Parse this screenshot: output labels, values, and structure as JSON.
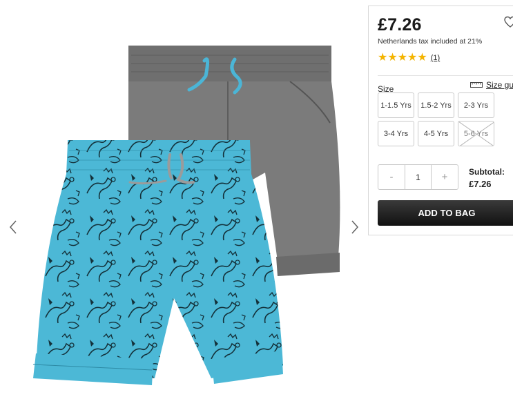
{
  "gallery": {
    "image_alt": "Two pack of boys shorts: grey chino shorts and turquoise dinosaur print shorts",
    "prev_icon": "chevron-left-icon",
    "next_icon": "chevron-right-icon"
  },
  "product": {
    "price": "£7.26",
    "tax_note": "Netherlands tax included at 21%",
    "rating": {
      "value": 5,
      "max": 5,
      "review_count": "(1)"
    },
    "wishlist_icon": "heart-icon"
  },
  "size": {
    "label": "Size",
    "guide_label": "Size guide",
    "guide_icon": "ruler-icon",
    "options": [
      {
        "label": "1-1.5 Yrs",
        "available": true
      },
      {
        "label": "1.5-2 Yrs",
        "available": true
      },
      {
        "label": "2-3 Yrs",
        "available": true
      },
      {
        "label": "3-4 Yrs",
        "available": true
      },
      {
        "label": "4-5 Yrs",
        "available": true
      },
      {
        "label": "5-6 Yrs",
        "available": false
      }
    ]
  },
  "quantity": {
    "minus": "-",
    "value": "1",
    "plus": "+"
  },
  "subtotal": {
    "label": "Subtotal:",
    "value": "£7.26"
  },
  "cta": {
    "add_to_bag": "ADD TO BAG"
  },
  "colors": {
    "star": "#f4b400",
    "button_dark": "#1e1e1e",
    "shorts_grey": "#7b7b7b",
    "shorts_turquoise": "#4cb8d6"
  }
}
